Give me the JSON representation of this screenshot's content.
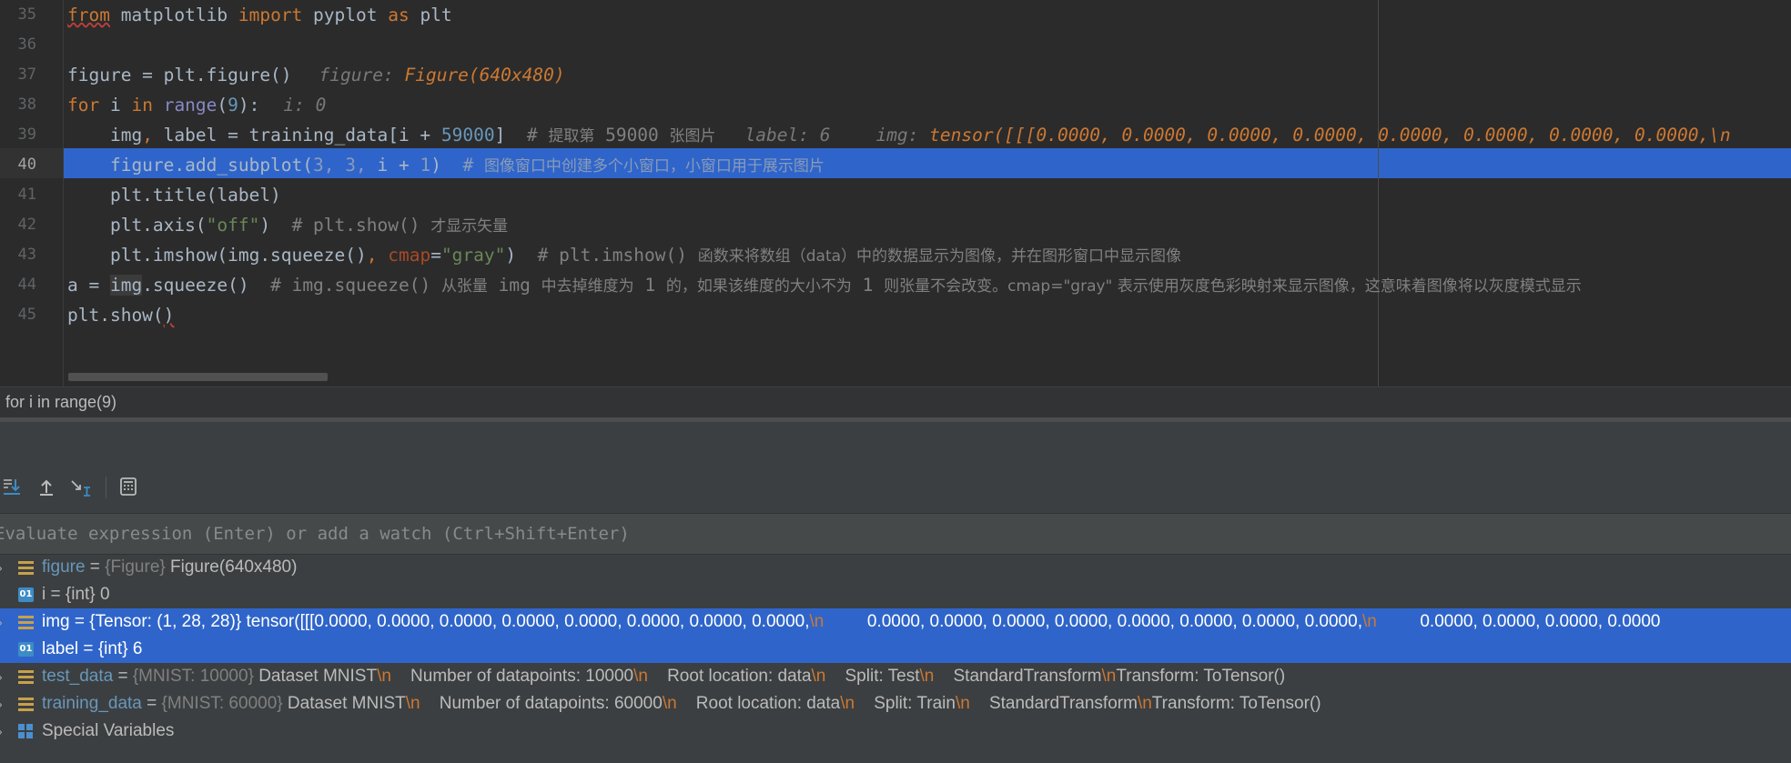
{
  "editor": {
    "line_numbers": [
      "35",
      "36",
      "37",
      "38",
      "39",
      "40",
      "41",
      "42",
      "43",
      "44",
      "45"
    ],
    "lines": {
      "l35": {
        "t1": "from",
        "t2": " matplotlib ",
        "t3": "import",
        "t4": " pyplot ",
        "t5": "as",
        "t6": " plt"
      },
      "l37": {
        "t1": "figure = plt.figure()",
        "hint_name": "figure: ",
        "hint_val": "Figure(640x480)"
      },
      "l38": {
        "kw_for": "for",
        "t1": " i ",
        "kw_in": "in",
        "t2": " ",
        "range": "range",
        "t3": "(",
        "n9": "9",
        "t4": "):",
        "hint": "i: 0"
      },
      "l39": {
        "t1": "    img",
        "comma": ",",
        "t2": " label = training_data[i + ",
        "num": "59000",
        "t3": "]  ",
        "cmt1": "# ",
        "cmt_cjk1": "提取第",
        "cmt2": " 59000 ",
        "cmt_cjk2": "张图片",
        "hint_label": "label: 6",
        "hint_img": "img: ",
        "hint_img_val": "tensor([[[0.0000, 0.0000, 0.0000, 0.0000, 0.0000, 0.0000, 0.0000, 0.0000,\\n"
      },
      "l40": {
        "t1": "    figure.add_subplot(",
        "n3a": "3",
        "c1": ", ",
        "n3b": "3",
        "c2": ", ",
        "t2": "i + ",
        "n1": "1",
        "t3": ")  ",
        "cmt": "# ",
        "cmt_cjk": "图像窗口中创建多个小窗口，小窗口用于展示图片"
      },
      "l41": {
        "t1": "    plt.title(label)"
      },
      "l42": {
        "t1": "    plt.axis(",
        "s1": "\"off\"",
        "t2": ")  ",
        "cmt": "# plt.show() ",
        "cmt_cjk": "才显示矢量"
      },
      "l43": {
        "t1": "    plt.imshow(img.squeeze()",
        "c1": ", ",
        "p1": "cmap",
        "eq": "=",
        "s1": "\"gray\"",
        "t2": ")  ",
        "cmt": "# plt.imshow() ",
        "cmt_cjk": "函数来将数组（data）中的数据显示为图像，并在图形窗口中显示图像"
      },
      "l44": {
        "t1": "a = ",
        "v1": "img",
        "t2": ".squeeze()  ",
        "cmt": "# img.squeeze() ",
        "cmt_cjk1": "从张量",
        "cmt2": " img ",
        "cmt_cjk2": "中去掉维度为",
        "cmt3": " 1 ",
        "cmt_cjk3": "的，如果该维度的大小不为",
        "cmt4": " 1 ",
        "cmt_cjk4": "则张量不会改变。cmap=\"gray\" 表示使用灰度色彩映射来显示图像，这意味着图像将以灰度模式显示"
      },
      "l45": {
        "t1": "plt.show(",
        "t2": ")"
      }
    }
  },
  "breadcrumb": "for i in range(9)",
  "debugger": {
    "toolbar": [
      "step-into-icon",
      "step-out-icon",
      "run-to-cursor-icon",
      "evaluate-expression-icon"
    ],
    "eval_placeholder": "Evaluate expression (Enter) or add a watch (Ctrl+Shift+Enter)",
    "variables": [
      {
        "expand": "›",
        "icon": "object-stack-icon",
        "name": "figure",
        "eq": " = ",
        "type": "{Figure} ",
        "value": "Figure(640x480)"
      },
      {
        "expand": "",
        "icon": "int-01-icon",
        "name": "i",
        "eq": " = ",
        "type": "{int} ",
        "value": "0"
      },
      {
        "expand": "›",
        "icon": "object-stack-icon",
        "name": "img",
        "eq": " = ",
        "type": "{Tensor: (1, 28, 28)} ",
        "value": "tensor([[[0.0000, 0.0000, 0.0000, 0.0000, 0.0000, 0.0000, 0.0000, 0.0000,\\n         0.0000, 0.0000, 0.0000, 0.0000, 0.0000, 0.0000, 0.0000, 0.0000,\\n         0.0000, 0.0000, 0.0000, 0.0000"
      },
      {
        "expand": "",
        "icon": "int-01-icon",
        "name": "label",
        "eq": " = ",
        "type": "{int} ",
        "value": "6"
      },
      {
        "expand": "›",
        "icon": "object-stack-icon",
        "name": "test_data",
        "eq": " = ",
        "type": "{MNIST: 10000} ",
        "value": "Dataset MNIST\\n    Number of datapoints: 10000\\n    Root location: data\\n    Split: Test\\n    StandardTransform\\nTransform: ToTensor()"
      },
      {
        "expand": "›",
        "icon": "object-stack-icon",
        "name": "training_data",
        "eq": " = ",
        "type": "{MNIST: 60000} ",
        "value": "Dataset MNIST\\n    Number of datapoints: 60000\\n    Root location: data\\n    Split: Train\\n    StandardTransform\\nTransform: ToTensor()"
      },
      {
        "expand": "›",
        "icon": "special-variables-icon",
        "name": "Special Variables",
        "eq": "",
        "type": "",
        "value": ""
      }
    ],
    "int_icon_text": "01"
  },
  "colors": {
    "selection": "#2f65ca",
    "keyword": "#cc7832",
    "number": "#6897bb",
    "string": "#6a8759",
    "comment": "#808080"
  }
}
